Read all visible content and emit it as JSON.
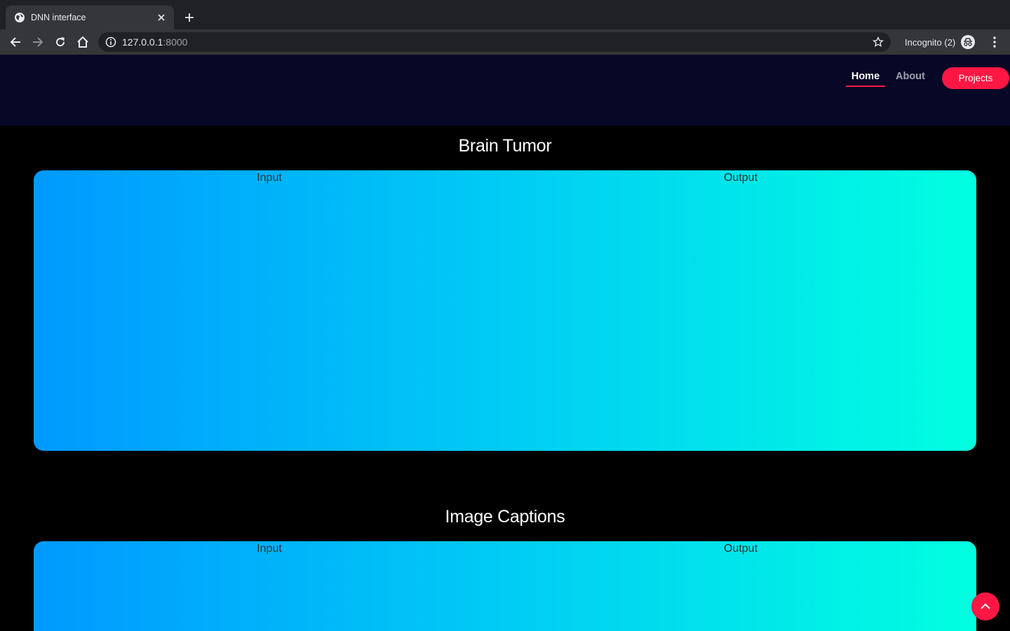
{
  "browser": {
    "tab_title": "DNN interface",
    "url_host": "127.0.0.1",
    "url_port": ":8000",
    "incognito_label": "Incognito (2)"
  },
  "nav": {
    "home": "Home",
    "about": "About",
    "projects": "Projects"
  },
  "sections": [
    {
      "title": "Brain Tumor",
      "input_label": "Input",
      "output_label": "Output"
    },
    {
      "title": "Image Captions",
      "input_label": "Input",
      "output_label": "Output"
    }
  ],
  "colors": {
    "accent": "#ff1744",
    "header_bg": "#070726",
    "gradient_start": "#0099ff",
    "gradient_end": "#00ffe0"
  },
  "icons": {
    "scroll_top": "chevron-up-icon"
  }
}
